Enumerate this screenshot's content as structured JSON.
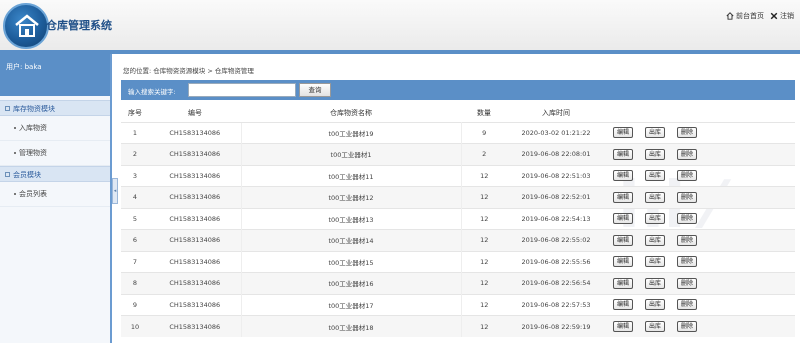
{
  "header": {
    "title": "仓库管理系统",
    "links": [
      {
        "label": "前台首页",
        "icon": "home-icon"
      },
      {
        "label": "注销",
        "icon": "close-icon"
      }
    ]
  },
  "sidebar": {
    "user_label": "用户: baka",
    "groups": [
      {
        "title": "库存物资模块",
        "items": [
          "入库物资",
          "管理物资"
        ]
      },
      {
        "title": "会员模块",
        "items": [
          "会员列表"
        ]
      }
    ]
  },
  "main": {
    "breadcrumb": "您的位置: 仓库物资资源模块 > 仓库物资管理",
    "search": {
      "label": "输入搜索关键字:",
      "value": "",
      "button": "查询"
    },
    "table": {
      "headers": [
        "序号",
        "编号",
        "仓库物资名称",
        "数量",
        "入库时间",
        ""
      ],
      "actions": [
        "编辑",
        "出库",
        "删除"
      ],
      "rows": [
        {
          "no": "1",
          "code": "CH1583134086",
          "name": "t00工业器材19",
          "qty": "9",
          "time": "2020-03-02 01:21:22"
        },
        {
          "no": "2",
          "code": "CH1583134086",
          "name": "t00工业器材1",
          "qty": "2",
          "time": "2019-06-08 22:08:01"
        },
        {
          "no": "3",
          "code": "CH1583134086",
          "name": "t00工业器材11",
          "qty": "12",
          "time": "2019-06-08 22:51:03"
        },
        {
          "no": "4",
          "code": "CH1583134086",
          "name": "t00工业器材12",
          "qty": "12",
          "time": "2019-06-08 22:52:01"
        },
        {
          "no": "5",
          "code": "CH1583134086",
          "name": "t00工业器材13",
          "qty": "12",
          "time": "2019-06-08 22:54:13"
        },
        {
          "no": "6",
          "code": "CH1583134086",
          "name": "t00工业器材14",
          "qty": "12",
          "time": "2019-06-08 22:55:02"
        },
        {
          "no": "7",
          "code": "CH1583134086",
          "name": "t00工业器材15",
          "qty": "12",
          "time": "2019-06-08 22:55:56"
        },
        {
          "no": "8",
          "code": "CH1583134086",
          "name": "t00工业器材16",
          "qty": "12",
          "time": "2019-06-08 22:56:54"
        },
        {
          "no": "9",
          "code": "CH1583134086",
          "name": "t00工业器材17",
          "qty": "12",
          "time": "2019-06-08 22:57:53"
        },
        {
          "no": "10",
          "code": "CH1583134086",
          "name": "t00工业器材18",
          "qty": "12",
          "time": "2019-06-08 22:59:19"
        }
      ]
    }
  },
  "colors": {
    "accent": "#5b8fc7",
    "title": "#1f4f88"
  }
}
